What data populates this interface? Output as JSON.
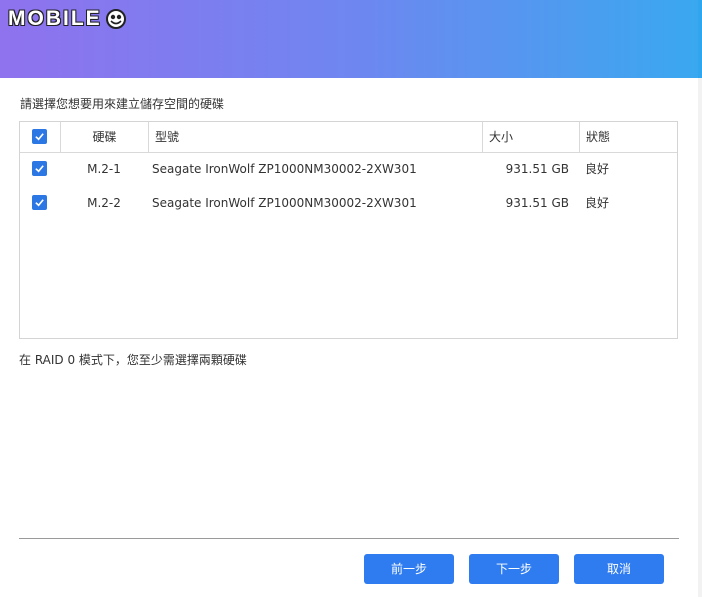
{
  "brand": {
    "logo_text": "MOBILE"
  },
  "wizard": {
    "instruction": "請選擇您想要用來建立儲存空間的硬碟",
    "note": "在 RAID 0 模式下，您至少需選擇兩顆硬碟"
  },
  "table": {
    "columns": {
      "disk": "硬碟",
      "model": "型號",
      "size": "大小",
      "status": "狀態"
    },
    "select_all_checked": true,
    "rows": [
      {
        "checked": true,
        "disk": "M.2-1",
        "model": "Seagate IronWolf ZP1000NM30002-2XW301",
        "size": "931.51 GB",
        "status": "良好"
      },
      {
        "checked": true,
        "disk": "M.2-2",
        "model": "Seagate IronWolf ZP1000NM30002-2XW301",
        "size": "931.51 GB",
        "status": "良好"
      }
    ]
  },
  "buttons": {
    "back": "前一步",
    "next": "下一步",
    "cancel": "取消"
  },
  "colors": {
    "header_gradient_start": "#8f72ee",
    "header_gradient_end": "#3aa8f0",
    "accent": "#2f7cf0",
    "checkbox": "#2b78e4"
  }
}
